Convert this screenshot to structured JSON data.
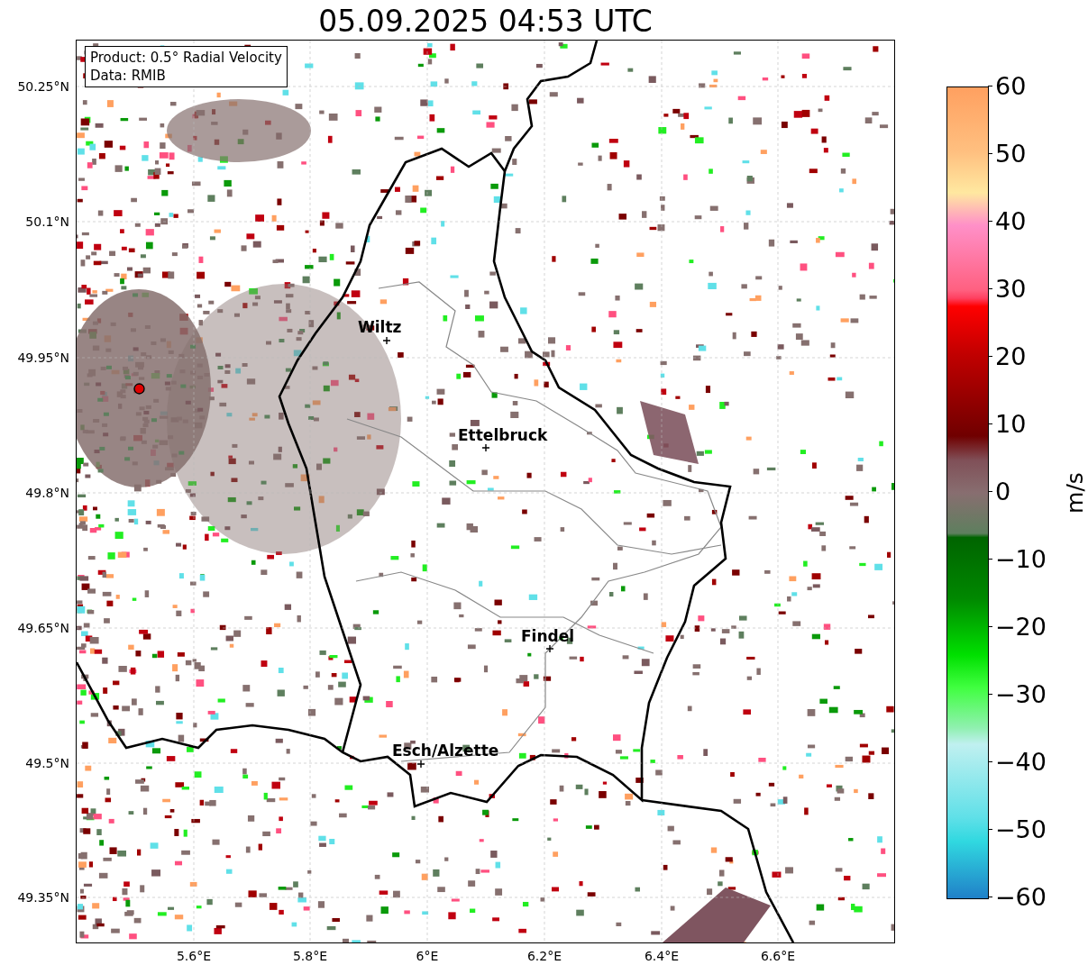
{
  "title": "05.09.2025 04:53 UTC",
  "product_box": [
    "Product: 0.5° Radial Velocity",
    "Data: RMIB"
  ],
  "lat_labels": [
    "50.25°N",
    "50.1°N",
    "49.95°N",
    "49.8°N",
    "49.65°N",
    "49.5°N",
    "49.35°N"
  ],
  "lon_labels": [
    "5.6°E",
    "5.8°E",
    "6°E",
    "6.2°E",
    "6.4°E",
    "6.6°E"
  ],
  "cities": [
    {
      "name": "Wiltz"
    },
    {
      "name": "Ettelbruck"
    },
    {
      "name": "Findel"
    },
    {
      "name": "Esch/Alzette"
    }
  ],
  "colorbar": {
    "label": "m/s",
    "ticks": [
      "60",
      "50",
      "40",
      "30",
      "20",
      "10",
      "0",
      "−10",
      "−20",
      "−30",
      "−40",
      "−50",
      "−60"
    ]
  }
}
